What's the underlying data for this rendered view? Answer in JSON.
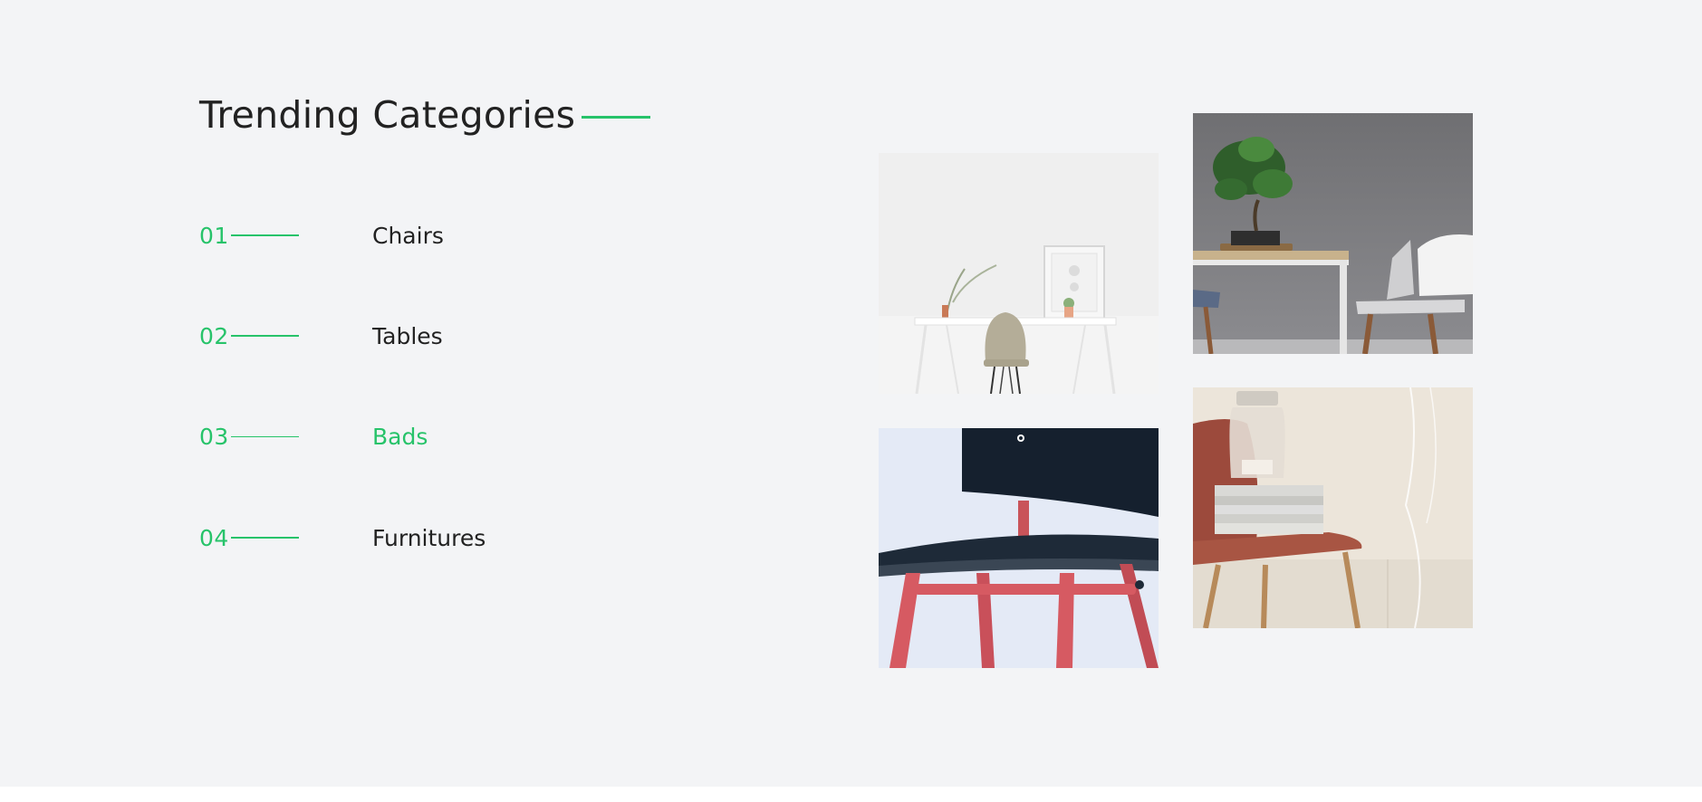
{
  "section": {
    "title": "Trending Categories"
  },
  "categories": [
    {
      "number": "01",
      "label": "Chairs",
      "active": false
    },
    {
      "number": "02",
      "label": "Tables",
      "active": false
    },
    {
      "number": "03",
      "label": "Bads",
      "active": true
    },
    {
      "number": "04",
      "label": "Furnitures",
      "active": false
    }
  ],
  "colors": {
    "accent": "#27c36a",
    "background": "#f3f4f6",
    "text": "#222222"
  },
  "images": [
    {
      "name": "white-desk-chair-photo"
    },
    {
      "name": "bonsai-table-photo"
    },
    {
      "name": "red-black-chair-photo"
    },
    {
      "name": "velvet-chair-photo"
    }
  ]
}
